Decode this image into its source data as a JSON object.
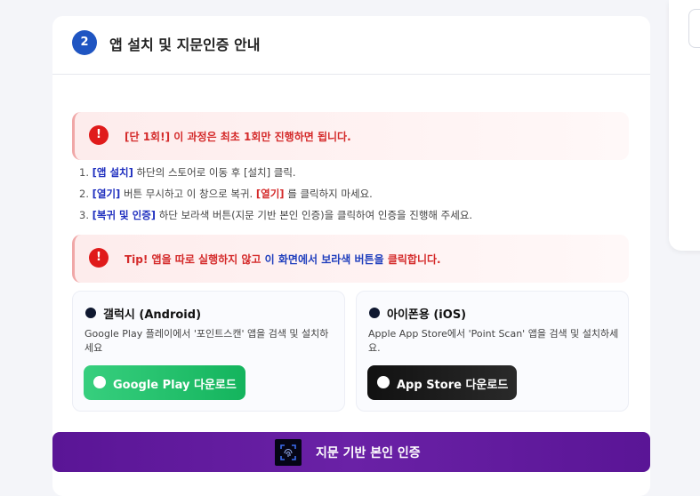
{
  "card": {
    "step_number": "2",
    "title": "앱 설치 및 지문인증 안내"
  },
  "alerts": [
    {
      "icon": "exclamation-icon",
      "text": "[단 1회!] 이 과정은 최초 1회만 진행하면 됩니다."
    },
    {
      "icon": "exclamation-icon",
      "prefix": "Tip! 앱을 따로 실행하지 않고 ",
      "highlight": "이 화면에서 보라색 버튼을",
      "suffix": " 클릭합니다."
    }
  ],
  "steps": [
    {
      "num": "1.",
      "keyword": "[앱 설치]",
      "text1": " 하단의 스토어로 이동 후 [설치] 클릭."
    },
    {
      "num": "2.",
      "keyword": "[열기]",
      "text1": " 버튼 무시하고 이 창으로 복귀. ",
      "keyword2": "[열기]",
      "text2": " 를 클릭하지 마세요."
    },
    {
      "num": "3.",
      "keyword": "[복귀 및 인증]",
      "text1": " 하단 보라색 버튼(지문 기반 본인 인증)을 클릭하여 인증을 진행해 주세요."
    }
  ],
  "downloads": {
    "android": {
      "title": "갤럭시 (Android)",
      "desc": "Google Play 플레이에서 '포인트스캔' 앱을 검색 및 설치하세요",
      "button": "Google Play 다운로드"
    },
    "ios": {
      "title": "아이폰용 (iOS)",
      "desc": "Apple App Store에서 'Point Scan' 앱을 검색 및 설치하세요.",
      "button": "App Store 다운로드"
    }
  },
  "cta": {
    "icon": "fingerprint-scan-icon",
    "label": "지문 기반 본인 인증"
  },
  "colors": {
    "step_badge": "#1f55c2",
    "alert_red": "#d42a2a",
    "keyword_blue": "#1f2fbf",
    "google_play_green": "#14b45d",
    "app_store_black": "#111111",
    "cta_purple": "#5a1596"
  }
}
